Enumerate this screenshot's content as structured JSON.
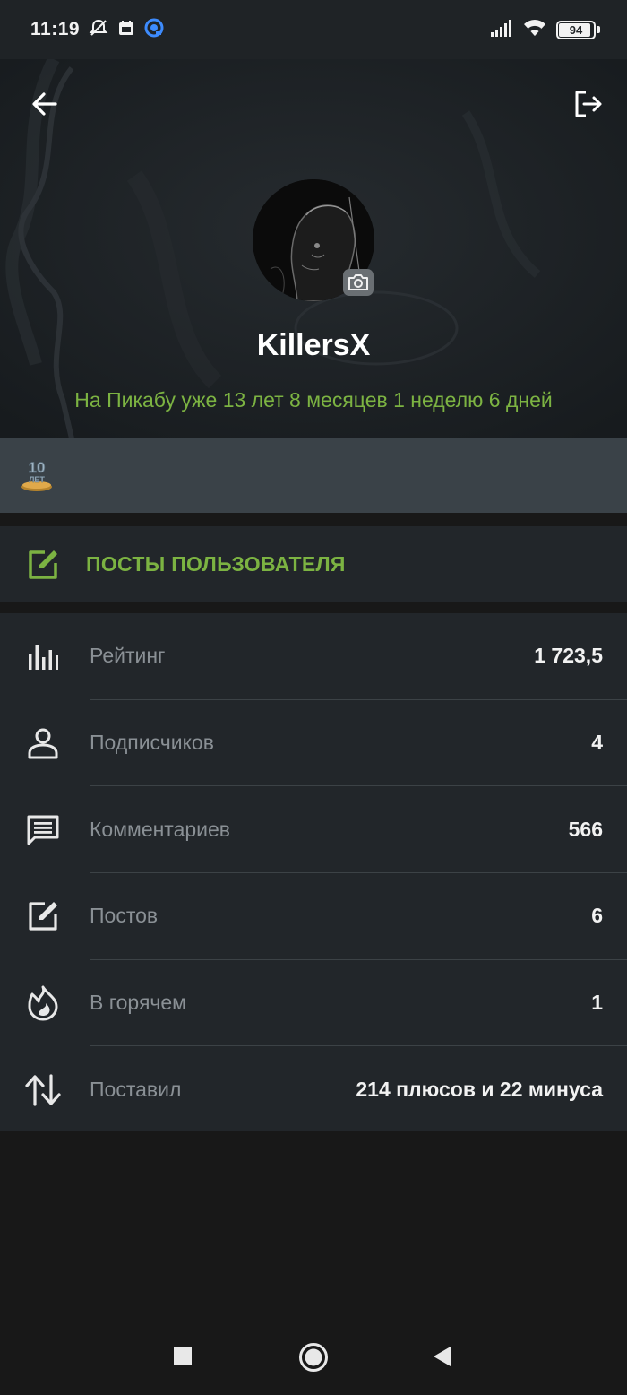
{
  "status_bar": {
    "time": "11:19",
    "battery": "94"
  },
  "profile": {
    "username": "KillersX",
    "membership": "На Пикабу уже 13 лет 8 месяцев 1 неделю 6 дней"
  },
  "awards": [
    {
      "icon": "10-years-badge-icon",
      "text": "10 ЛЕТ"
    }
  ],
  "posts_button": {
    "label": "ПОСТЫ ПОЛЬЗОВАТЕЛЯ"
  },
  "stats": [
    {
      "icon": "bar-chart-icon",
      "label": "Рейтинг",
      "value": "1 723,5"
    },
    {
      "icon": "person-icon",
      "label": "Подписчиков",
      "value": "4"
    },
    {
      "icon": "comment-icon",
      "label": "Комментариев",
      "value": "566"
    },
    {
      "icon": "edit-icon",
      "label": "Постов",
      "value": "6"
    },
    {
      "icon": "flame-icon",
      "label": "В горячем",
      "value": "1"
    },
    {
      "icon": "up-down-arrows-icon",
      "label": "Поставил",
      "value": "214 плюсов и 22 минуса"
    }
  ],
  "colors": {
    "accent": "#7cb342",
    "background": "#181818",
    "panel": "#22262a",
    "awards_bar": "#3a4248",
    "label": "#8a9095"
  }
}
